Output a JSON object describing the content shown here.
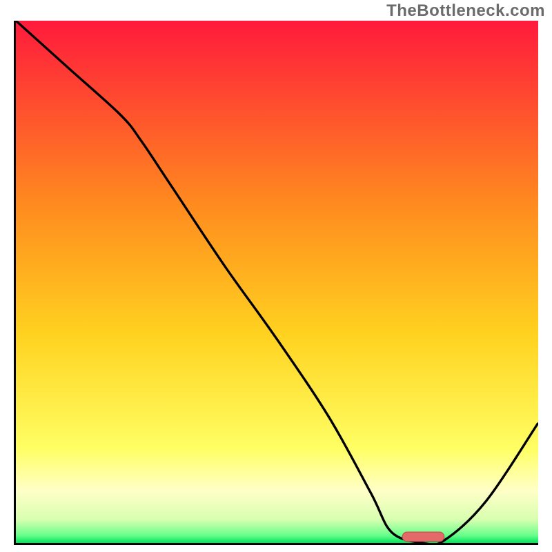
{
  "watermark": "TheBottleneck.com",
  "colors": {
    "gradient_top": "#ff1a3c",
    "gradient_mid_upper": "#ff8a1f",
    "gradient_mid": "#ffd21f",
    "gradient_mid_lower": "#ffff64",
    "gradient_pale": "#ffffc8",
    "gradient_bottom": "#00e45a",
    "curve": "#000000",
    "marker_fill": "#e46a6a",
    "marker_stroke": "#c24d4d",
    "axis": "#000000"
  },
  "chart_data": {
    "type": "line",
    "title": "",
    "xlabel": "",
    "ylabel": "",
    "xlim": [
      0,
      100
    ],
    "ylim": [
      0,
      100
    ],
    "x": [
      0,
      10,
      20,
      24,
      30,
      40,
      50,
      60,
      68,
      72,
      78,
      82,
      90,
      100
    ],
    "values": [
      100,
      91,
      82,
      77,
      68,
      53,
      39,
      24,
      9.5,
      2,
      0,
      0.5,
      8,
      23
    ],
    "marker": {
      "x_start": 74,
      "x_end": 82,
      "y": 1.2
    },
    "gradient_stops": [
      {
        "offset": 0.0,
        "color": "#ff1a3c"
      },
      {
        "offset": 0.35,
        "color": "#ff8a1f"
      },
      {
        "offset": 0.6,
        "color": "#ffd21f"
      },
      {
        "offset": 0.82,
        "color": "#ffff64"
      },
      {
        "offset": 0.9,
        "color": "#ffffc8"
      },
      {
        "offset": 0.955,
        "color": "#d8ffb0"
      },
      {
        "offset": 0.985,
        "color": "#6aff8c"
      },
      {
        "offset": 1.0,
        "color": "#00e45a"
      }
    ]
  }
}
